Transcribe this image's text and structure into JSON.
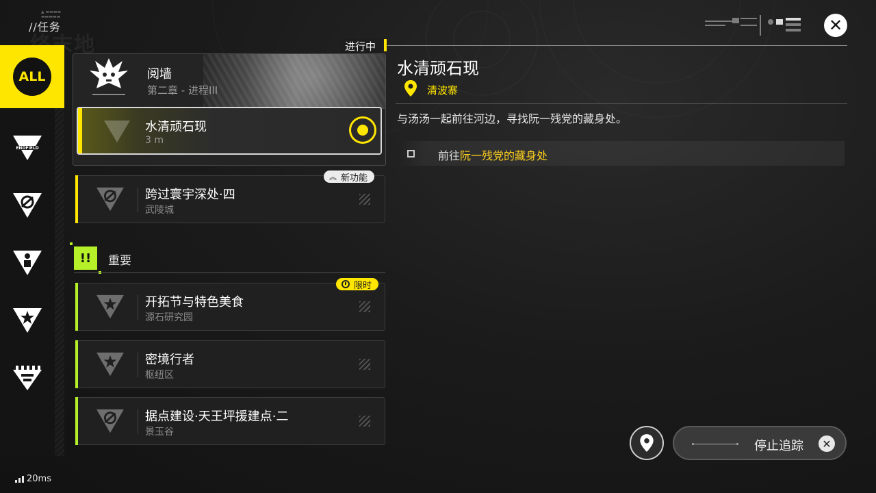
{
  "header": {
    "title": "//任务",
    "close_icon": "close-x-icon",
    "watermark": "终末地"
  },
  "rail": {
    "items": [
      {
        "id": "all",
        "label": "ALL",
        "icon": "all-badge"
      },
      {
        "id": "endfield",
        "label": "ENDFIELD",
        "icon": "endfield-v-icon"
      },
      {
        "id": "no-entry",
        "icon": "slash-circle-triangle-icon"
      },
      {
        "id": "person",
        "icon": "person-triangle-icon"
      },
      {
        "id": "star",
        "icon": "star-triangle-icon"
      },
      {
        "id": "castle",
        "icon": "castle-triangle-icon"
      }
    ]
  },
  "quest_list": {
    "ongoing_label": "进行中",
    "chapter": {
      "title": "阅墙",
      "subtitle": "第二章 - 进程III"
    },
    "active_quest": {
      "name": "水清顽石现",
      "distance": "3 m"
    },
    "other_quests": [
      {
        "name": "跨过寰宇深处·四",
        "location": "武陵城",
        "tag": "新功能",
        "bar_color": "#ffe600"
      }
    ],
    "section": {
      "label": "重要",
      "badge": "!!",
      "color": "#b6f028"
    },
    "important_quests": [
      {
        "name": "开拓节与特色美食",
        "location": "源石研究园",
        "tag": "限时",
        "bar_color": "#b6f028"
      },
      {
        "name": "密境行者",
        "location": "枢纽区",
        "bar_color": "#b6f028"
      },
      {
        "name": "据点建设·天王坪援建点·二",
        "location": "景玉谷",
        "bar_color": "#b6f028"
      }
    ]
  },
  "detail": {
    "title": "水清顽石现",
    "location": "清波寨",
    "description": "与汤汤一起前往河边，寻找阮一残党的藏身处。",
    "objective_prefix": "前往",
    "objective_target": "阮一残党的藏身处"
  },
  "bottom": {
    "stop_tracking_label": "停止追踪",
    "ping": "20ms"
  },
  "colors": {
    "accent_yellow": "#ffe600",
    "accent_green": "#b6f028"
  }
}
